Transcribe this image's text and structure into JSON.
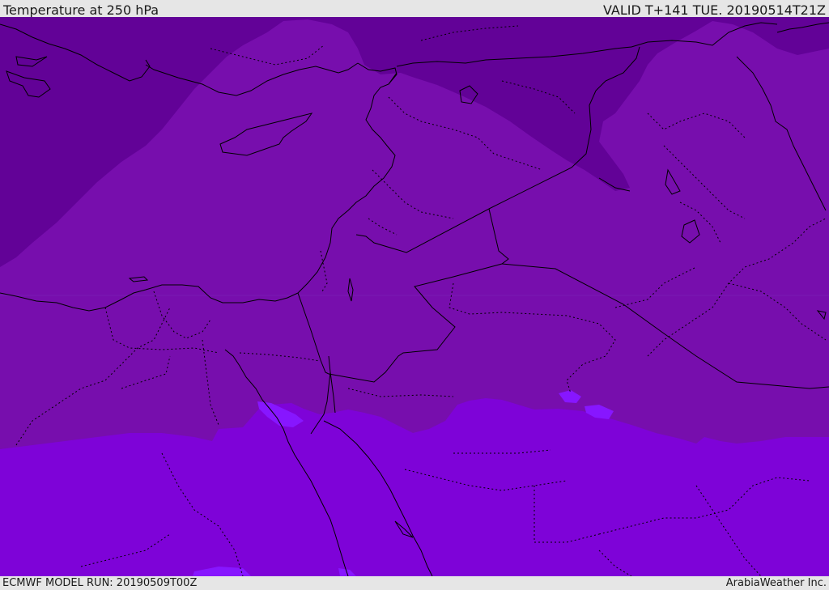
{
  "header": {
    "title": "Temperature at 250 hPa",
    "valid_time": "VALID T+141 TUE. 20190514T21Z"
  },
  "footer": {
    "model_run": "ECMWF MODEL RUN: 20190509T00Z",
    "credit": "ArabiaWeather Inc."
  },
  "map": {
    "colors": {
      "cold_band": "#620297",
      "mid_band": "#770ead",
      "warm_band": "#7e03d8",
      "warm_patch": "#8716ff",
      "coastline": "#000000",
      "borders": "#000000"
    }
  }
}
